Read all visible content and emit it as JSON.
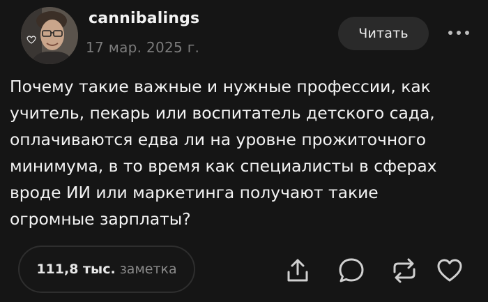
{
  "author": {
    "username": "cannibalings",
    "date": "17 мар. 2025 г."
  },
  "header": {
    "read_label": "Читать",
    "more_icon": "ellipsis-icon"
  },
  "post": {
    "text": "Почему такие важные и нужные профессии, как\nучитель, пекарь или воспитатель детского сада,\nоплачиваются едва ли на уровне прожиточного\nминимума, в то время как специалисты в сферах\nвроде ИИ или маркетинга получают такие\nогромные зарплаты?"
  },
  "footer": {
    "note_count": "111,8 тыс.",
    "note_label": "заметка",
    "actions": [
      "share-icon",
      "comment-icon",
      "reblog-icon",
      "like-icon"
    ]
  },
  "colors": {
    "background": "#151515",
    "text": "#f3f3f3",
    "muted": "#7c7c7c",
    "button_bg": "#2a2a2a",
    "icon": "#d0d0d0"
  }
}
